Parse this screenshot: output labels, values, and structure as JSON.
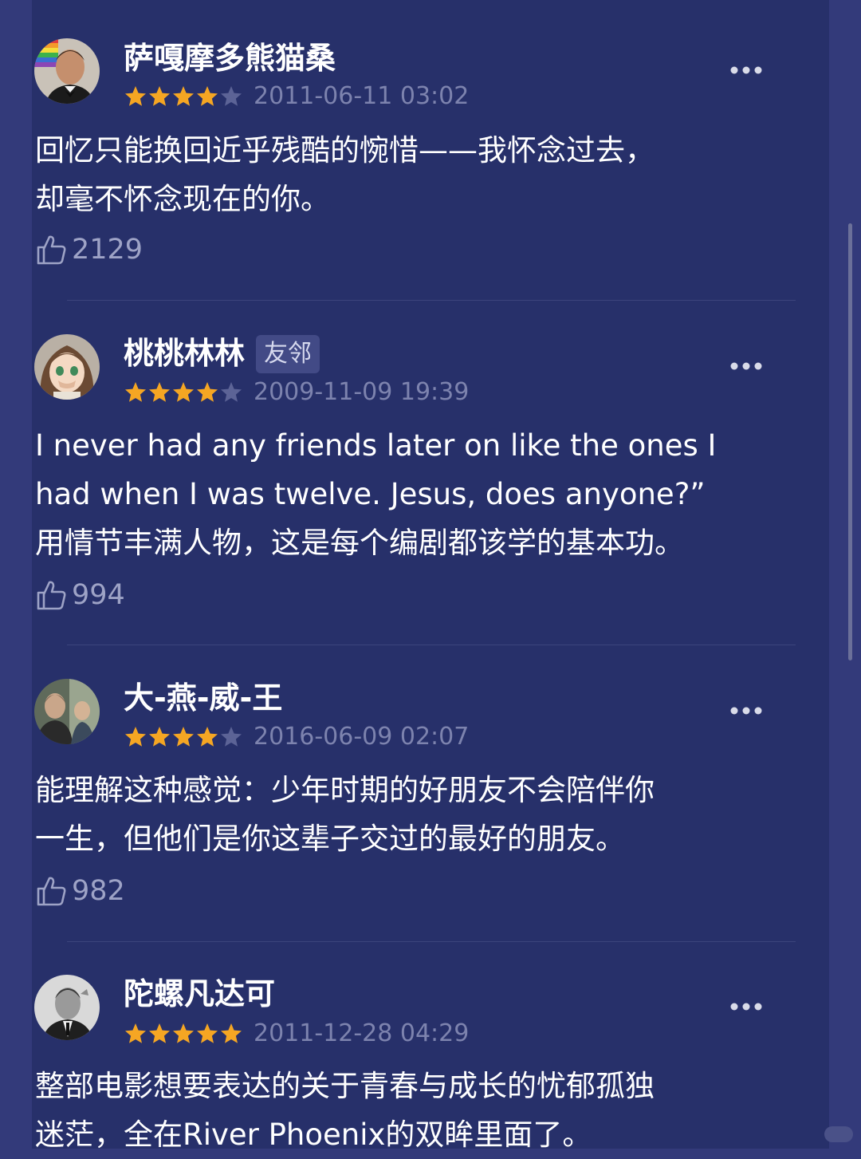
{
  "theme": {
    "background": "#27306a",
    "star_filled": "#f5a623",
    "star_empty": "#5c6396",
    "text": "#ffffff",
    "meta_text": "#7d83ae"
  },
  "icons": {
    "more": "more-dots-icon",
    "like": "thumbs-up-icon",
    "star": "star-icon"
  },
  "reviews": [
    {
      "name": "萨嘎摩多熊猫桑",
      "badge": "",
      "rating": 4,
      "max_rating": 5,
      "date": "2011-06-11 03:02",
      "text": "回忆只能换回近乎残酷的惋惜——我怀念过去，\n却毫不怀念现在的你。",
      "likes": "2129"
    },
    {
      "name": "桃桃林林",
      "badge": "友邻",
      "rating": 4,
      "max_rating": 5,
      "date": "2009-11-09 19:39",
      "text": "I never had any friends later on like the ones I\nhad when I was twelve. Jesus, does anyone?”\n用情节丰满人物，这是每个编剧都该学的基本功。",
      "likes": "994"
    },
    {
      "name": "大-燕-威-王",
      "badge": "",
      "rating": 4,
      "max_rating": 5,
      "date": "2016-06-09 02:07",
      "text": "能理解这种感觉：少年时期的好朋友不会陪伴你\n一生，但他们是你这辈子交过的最好的朋友。",
      "likes": "982"
    },
    {
      "name": "陀螺凡达可",
      "badge": "",
      "rating": 5,
      "max_rating": 5,
      "date": "2011-12-28 04:29",
      "text": "整部电影想要表达的关于青春与成长的忧郁孤独\n迷茫，全在River Phoenix的双眸里面了。",
      "likes": ""
    }
  ]
}
